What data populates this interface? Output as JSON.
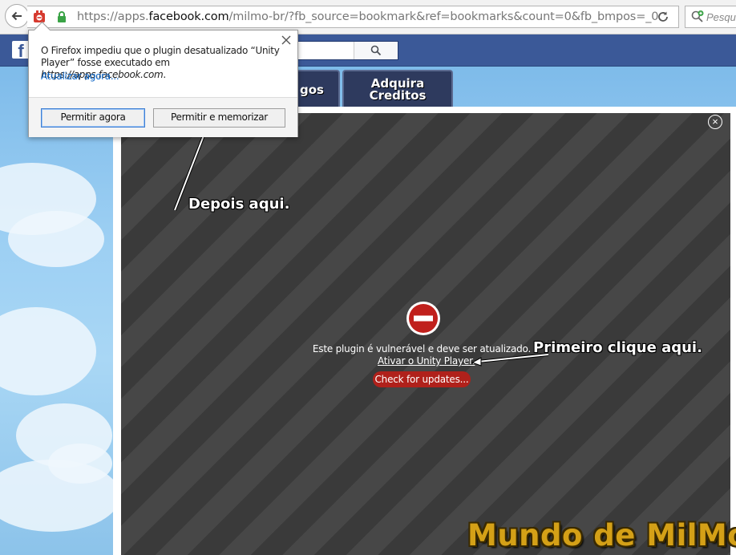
{
  "browser": {
    "url_prefix": "https://apps.",
    "url_host": "facebook.com",
    "url_suffix": "/milmo-br/?fb_source=bookmark&ref=bookmarks&count=0&fb_bmpos=_0",
    "search_placeholder": "Pesqu"
  },
  "facebook": {
    "logo": "f"
  },
  "game_tabs": {
    "jogos_label": "gos",
    "creditos_line1": "Adquira",
    "creditos_line2": "Creditos"
  },
  "popup": {
    "message_part1": "O Firefox impediu que o plugin desatualizado “Unity Player” fosse executado em ",
    "message_site": "https://apps.facebook.com",
    "message_end": ".",
    "update_link": "Atualizar agora...",
    "allow_now": "Permitir agora",
    "allow_remember": "Permitir e memorizar"
  },
  "plugin": {
    "message": "Este plugin é vulnerável e deve ser atualizado.",
    "activate_link": "Ativar o Unity Player.",
    "check_updates": "Check for updates..."
  },
  "annotations": {
    "first": "Primeiro clique aqui.",
    "then": "Depois aqui."
  },
  "watermark": "Mundo de MilMo",
  "colors": {
    "facebook_blue": "#3b5998",
    "block_red": "#c0201c",
    "link_blue": "#0a64c6",
    "watermark_gold": "#d4a017"
  }
}
